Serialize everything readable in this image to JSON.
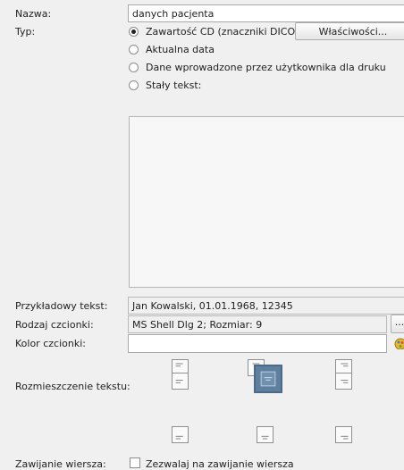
{
  "form": {
    "name_label": "Nazwa:",
    "name_value": "danych pacjenta",
    "type_label": "Typ:",
    "type_options": [
      "Zawartość CD (znaczniki DICOM)",
      "Aktualna data",
      "Dane wprowadzone przez użytkownika dla druku",
      "Stały tekst:"
    ],
    "selected_type": 0,
    "properties_button": "Właściwości...",
    "sample_label": "Przykładowy tekst:",
    "sample_value": "Jan Kowalski, 01.01.1968, 12345",
    "font_label": "Rodzaj czcionki:",
    "font_value": "MS Shell Dlg 2; Rozmiar: 9",
    "font_button": "...",
    "color_label": "Kolor czcionki:",
    "color_value": "",
    "align_label": "Rozmieszczenie tekstu:",
    "alignment_selected": "middle-center",
    "wrap_label": "Zawijanie wiersza:",
    "wrap_checkbox_label": "Zezwalaj na zawijanie wiersza",
    "wrap_checked": false
  },
  "colors": {
    "selected_align": "#5f7f9e",
    "palette_icon": "#e8b730"
  }
}
